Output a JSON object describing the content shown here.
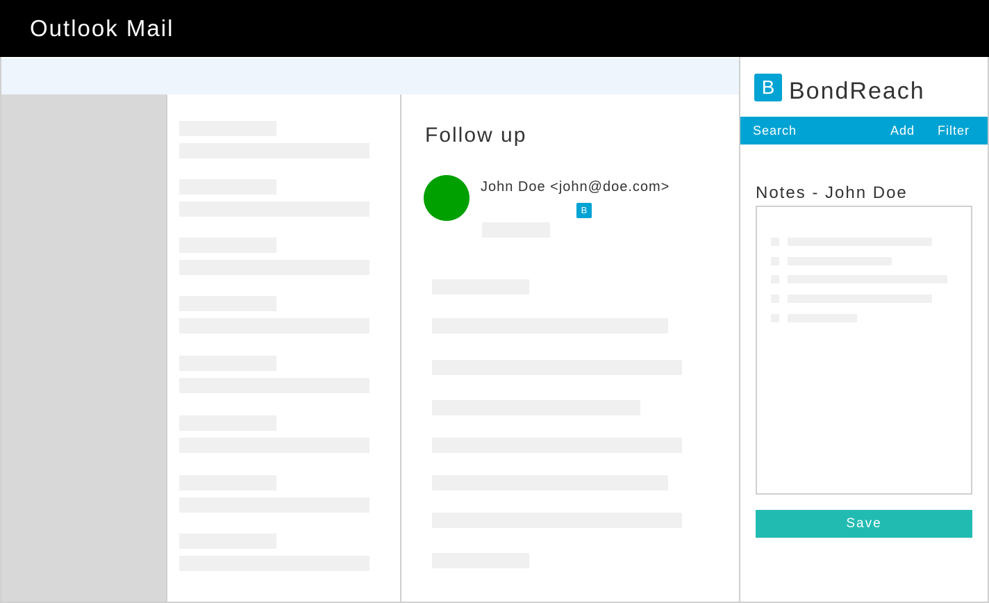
{
  "window": {
    "title": "Outlook Mail"
  },
  "message": {
    "subject": "Follow up",
    "sender": "John Doe <john@doe.com>",
    "badge": "B"
  },
  "addin": {
    "logo_letter": "B",
    "brand": "BondReach",
    "nav": {
      "search": "Search",
      "add": "Add",
      "filter": "Filter"
    },
    "notes_title": "Notes - John Doe",
    "save_label": "Save"
  },
  "colors": {
    "titlebar": "#000000",
    "ribbon": "#eef5fc",
    "folder_pane": "#d8d8d8",
    "avatar": "#00a000",
    "brand_blue": "#00a3d3",
    "save_button": "#22bbb2"
  }
}
